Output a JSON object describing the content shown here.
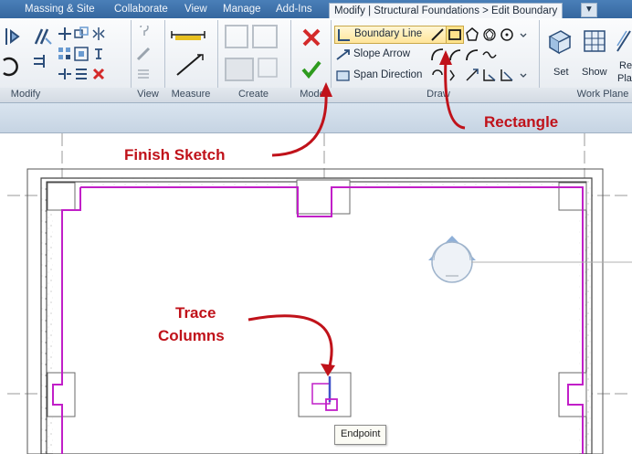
{
  "ribbon_tabs": [
    {
      "label": "Massing & Site"
    },
    {
      "label": "Collaborate"
    },
    {
      "label": "View"
    },
    {
      "label": "Manage"
    },
    {
      "label": "Add-Ins"
    },
    {
      "label": "Modify | Structural Foundations > Edit Boundary",
      "active": true
    },
    {
      "label": "▾"
    }
  ],
  "panels": {
    "modify": "Modify",
    "view": "View",
    "measure": "Measure",
    "create": "Create",
    "mode": "Mode",
    "draw": "Draw",
    "work_plane": "Work Plane"
  },
  "draw_buttons": {
    "boundary_line": "Boundary Line",
    "slope_arrow": "Slope Arrow",
    "span_direction": "Span Direction"
  },
  "work_plane_buttons": {
    "set": "Set",
    "show": "Show",
    "ref_plane_line1": "Re",
    "ref_plane_line2": "Plan"
  },
  "callouts": {
    "rectangle": "Rectangle",
    "finish_sketch": "Finish Sketch",
    "trace_line1": "Trace",
    "trace_line2": "Columns"
  },
  "snap_tooltip": "Endpoint",
  "colors": {
    "sketch_line": "#c11fc8",
    "callout_red": "#c0121a",
    "ribbon_blue": "#35679f",
    "finish_green": "#2e9b1e",
    "cancel_red": "#d42a2a"
  }
}
